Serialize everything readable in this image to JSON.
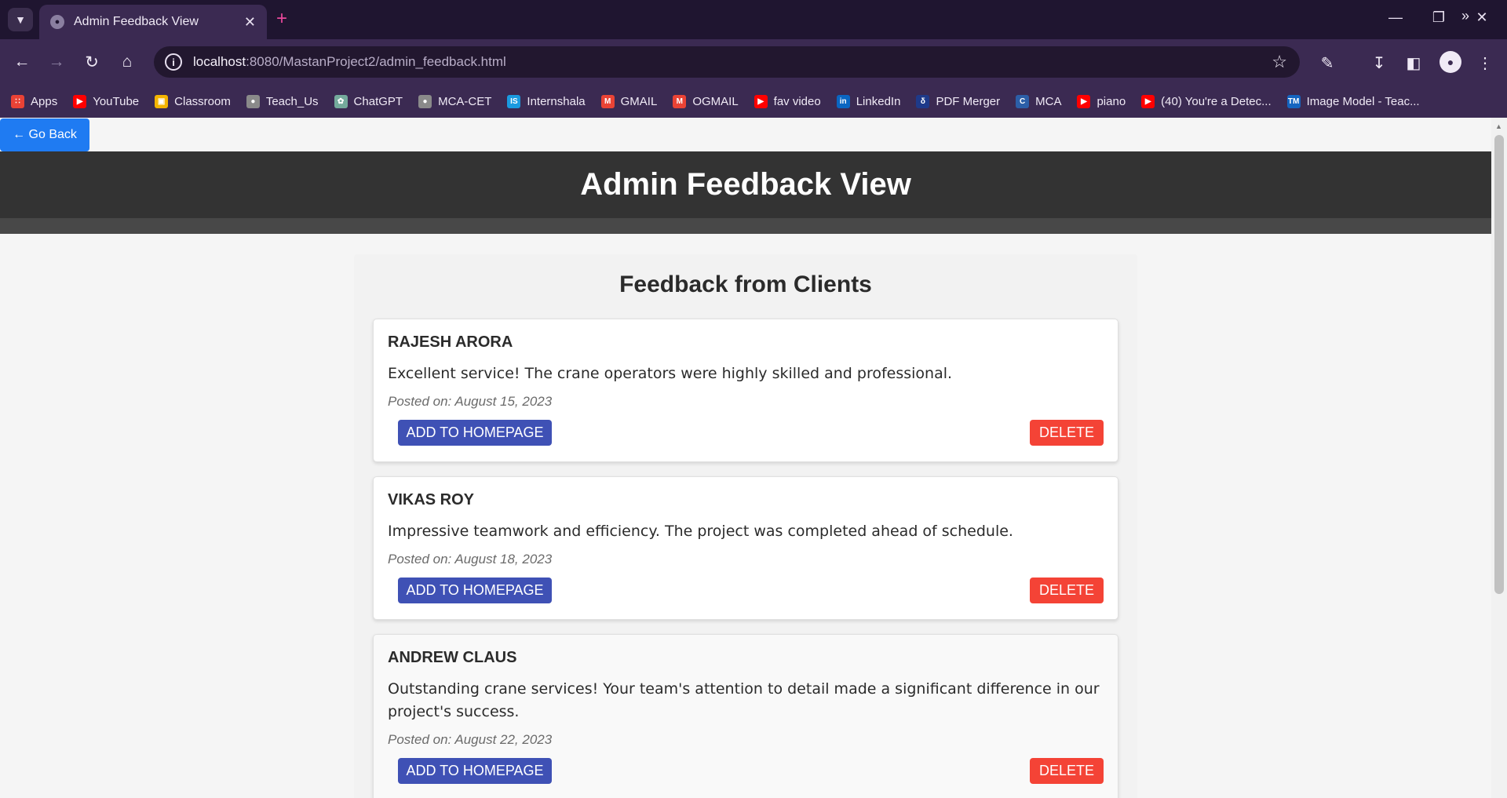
{
  "browser": {
    "tab_title": "Admin Feedback View",
    "url_host": "localhost",
    "url_path": ":8080/MastanProject2/admin_feedback.html",
    "bookmarks": [
      {
        "label": "Apps",
        "icon": "apps-grid-icon",
        "color": "#e94235"
      },
      {
        "label": "YouTube",
        "icon": "youtube-icon",
        "color": "#ff0000"
      },
      {
        "label": "Classroom",
        "icon": "classroom-icon",
        "color": "#f4b400"
      },
      {
        "label": "Teach_Us",
        "icon": "globe-icon",
        "color": "#8a8a8a"
      },
      {
        "label": "ChatGPT",
        "icon": "chatgpt-icon",
        "color": "#74aa9c"
      },
      {
        "label": "MCA-CET",
        "icon": "globe-icon",
        "color": "#8a8a8a"
      },
      {
        "label": "Internshala",
        "icon": "internshala-icon",
        "color": "#1a9ae0"
      },
      {
        "label": "GMAIL",
        "icon": "gmail-icon",
        "color": "#ea4335"
      },
      {
        "label": "OGMAIL",
        "icon": "gmail-icon",
        "color": "#ea4335"
      },
      {
        "label": "fav video",
        "icon": "youtube-icon",
        "color": "#ff0000"
      },
      {
        "label": "LinkedIn",
        "icon": "linkedin-icon",
        "color": "#0a66c2"
      },
      {
        "label": "PDF Merger",
        "icon": "pdf-merger-icon",
        "color": "#1e3a8a"
      },
      {
        "label": "MCA",
        "icon": "cet-icon",
        "color": "#2c5fa8"
      },
      {
        "label": "piano",
        "icon": "youtube-icon",
        "color": "#ff0000"
      },
      {
        "label": "(40) You're a Detec...",
        "icon": "youtube-icon",
        "color": "#ff0000"
      },
      {
        "label": "Image Model - Teac...",
        "icon": "tm-icon",
        "color": "#1565c0"
      }
    ]
  },
  "page": {
    "go_back_label": "← Go Back",
    "title": "Admin Feedback View",
    "section_title": "Feedback from Clients",
    "add_label": "ADD TO HOMEPAGE",
    "delete_label": "DELETE",
    "feedback": [
      {
        "name": "RAJESH ARORA",
        "message": "Excellent service! The crane operators were highly skilled and professional.",
        "posted": "Posted on: August 15, 2023"
      },
      {
        "name": "VIKAS ROY",
        "message": "Impressive teamwork and efficiency. The project was completed ahead of schedule.",
        "posted": "Posted on: August 18, 2023"
      },
      {
        "name": "ANDREW CLAUS",
        "message": "Outstanding crane services! Your team's attention to detail made a significant difference in our project's success.",
        "posted": "Posted on: August 22, 2023"
      }
    ]
  },
  "colors": {
    "header_bg": "#333333",
    "add_button": "#3f51b5",
    "delete_button": "#f44336",
    "go_back_button": "#1f7bf2"
  }
}
